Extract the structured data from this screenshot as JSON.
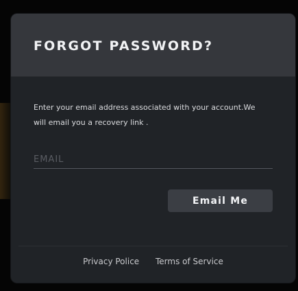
{
  "modal": {
    "title": "FORGOT PASSWORD?",
    "description": "Enter your email address associated with your account.We will email you a recovery link .",
    "email_field": {
      "placeholder": "EMAIL",
      "value": ""
    },
    "submit_label": "Email Me"
  },
  "footer": {
    "links": [
      {
        "label": "Privacy Police"
      },
      {
        "label": "Terms of Service"
      }
    ]
  },
  "colors": {
    "page_background": "#000000",
    "modal_body": "#202327",
    "modal_header": "#35373c",
    "button": "#3b3e44",
    "text_primary": "#f2f3f5",
    "placeholder": "#5a5d63"
  }
}
